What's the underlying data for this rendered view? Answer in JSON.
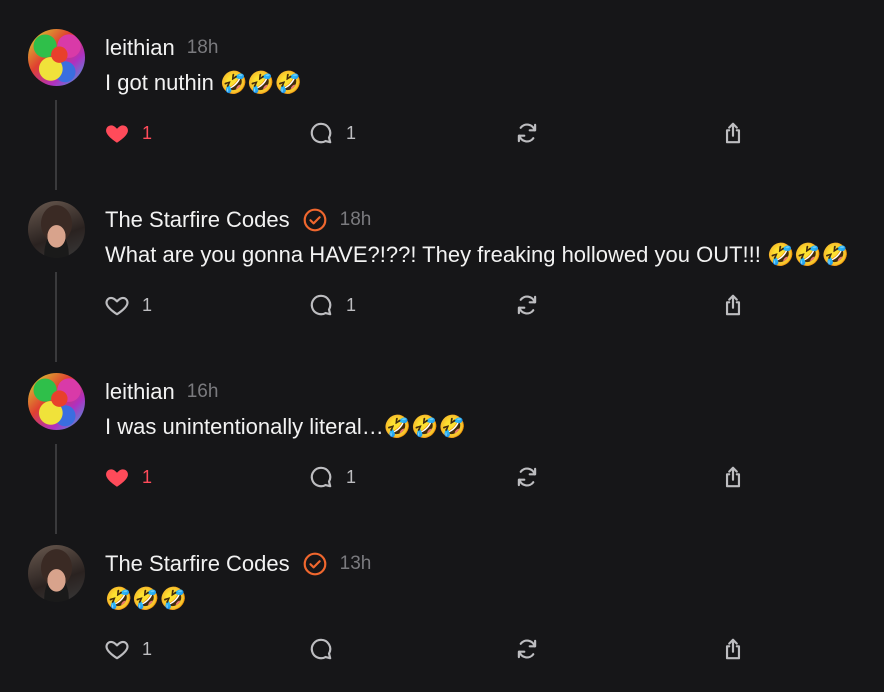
{
  "colors": {
    "background": "#161618",
    "liked": "#ff4b5a",
    "verified": "#f0672e",
    "muted": "#7a7a7e"
  },
  "posts": [
    {
      "username": "leithian",
      "verified": false,
      "time": "18h",
      "text": "I got nuthin 🤣🤣🤣",
      "liked": true,
      "like_count": "1",
      "reply_count": "1",
      "avatar": "leithian-avatar"
    },
    {
      "username": "The Starfire Codes",
      "verified": true,
      "time": "18h",
      "text": "What are you gonna HAVE?!??! They freaking hollowed you OUT!!! 🤣🤣🤣",
      "liked": false,
      "like_count": "1",
      "reply_count": "1",
      "avatar": "starfire-avatar"
    },
    {
      "username": "leithian",
      "verified": false,
      "time": "16h",
      "text": "I was unintentionally literal…🤣🤣🤣",
      "liked": true,
      "like_count": "1",
      "reply_count": "1",
      "avatar": "leithian-avatar"
    },
    {
      "username": "The Starfire Codes",
      "verified": true,
      "time": "13h",
      "text": "🤣🤣🤣",
      "liked": false,
      "like_count": "1",
      "reply_count": "",
      "avatar": "starfire-avatar"
    }
  ],
  "icons": {
    "like": "heart-icon",
    "reply": "comment-icon",
    "repost": "repost-icon",
    "share": "share-icon",
    "verified": "verified-badge-icon"
  }
}
